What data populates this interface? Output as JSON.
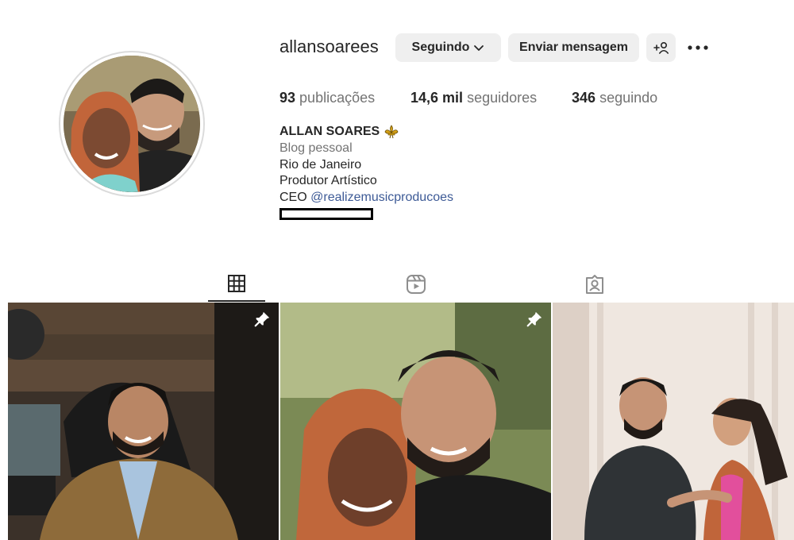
{
  "profile": {
    "username": "allansoarees",
    "following_button": "Seguindo",
    "message_button": "Enviar mensagem",
    "stats": {
      "posts_count": "93",
      "posts_label": "publicações",
      "followers_count": "14,6 mil",
      "followers_label": "seguidores",
      "following_count": "346",
      "following_label": "seguindo"
    },
    "bio": {
      "name": "ALLAN SOARES",
      "category": "Blog pessoal",
      "line1": "Rio de Janeiro",
      "line2": "Produtor Artístico",
      "ceo_prefix": "CEO",
      "ceo_mention": "@realizemusicproducoes"
    }
  },
  "icons": {
    "tab_posts": "grid-icon",
    "tab_reels": "reels-icon",
    "tab_tagged": "tagged-icon",
    "pinned": "pin-icon",
    "name_emoji": "fleur-de-lis-icon"
  },
  "colors": {
    "mention": "#3d5a96",
    "button_bg": "#efefef",
    "secondary_text": "#737373"
  }
}
